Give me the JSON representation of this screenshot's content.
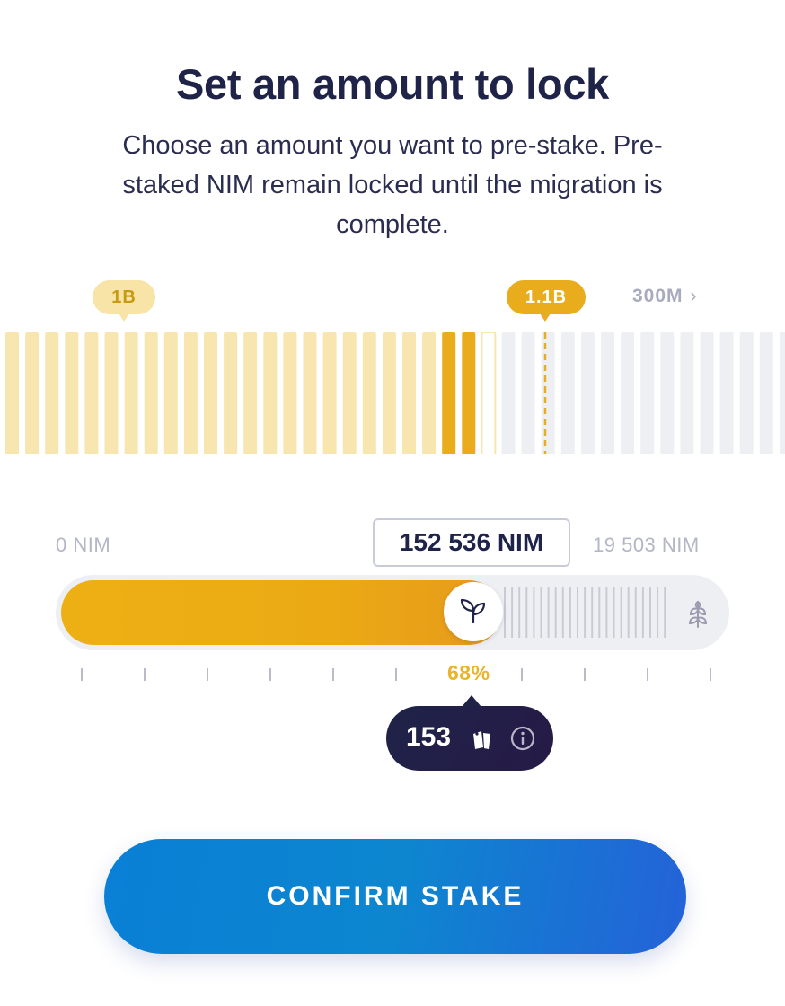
{
  "header": {
    "title": "Set an amount to lock",
    "subtitle": "Choose an amount you want to pre-stake. Pre-staked NIM remain locked until the migration is complete."
  },
  "graph": {
    "marker_left": "1B",
    "marker_right": "1.1B",
    "next_label": "300M",
    "bar_states": [
      "light",
      "light",
      "light",
      "light",
      "light",
      "light",
      "light",
      "light",
      "light",
      "light",
      "light",
      "light",
      "light",
      "light",
      "light",
      "light",
      "light",
      "light",
      "light",
      "light",
      "light",
      "light",
      "dark",
      "dark",
      "outline",
      "grey",
      "grey",
      "grey",
      "grey",
      "grey",
      "grey",
      "grey",
      "grey",
      "grey",
      "grey",
      "grey",
      "grey",
      "grey",
      "grey",
      "grey"
    ],
    "colors": {
      "light": "#f7e6b0",
      "dark": "#e9ac1c",
      "grey": "#eeeff3",
      "dashed": "#e9ac1c"
    }
  },
  "slider": {
    "min_label": "0 NIM",
    "max_label": "19 503 NIM",
    "amount": "152 536 NIM",
    "percent_label": "68%",
    "fill_fraction": 0.68
  },
  "tooltip": {
    "value": "153",
    "ticket_icon": "ticket-icon",
    "info_icon": "info-icon"
  },
  "confirm_button": {
    "label": "CONFIRM STAKE"
  }
}
